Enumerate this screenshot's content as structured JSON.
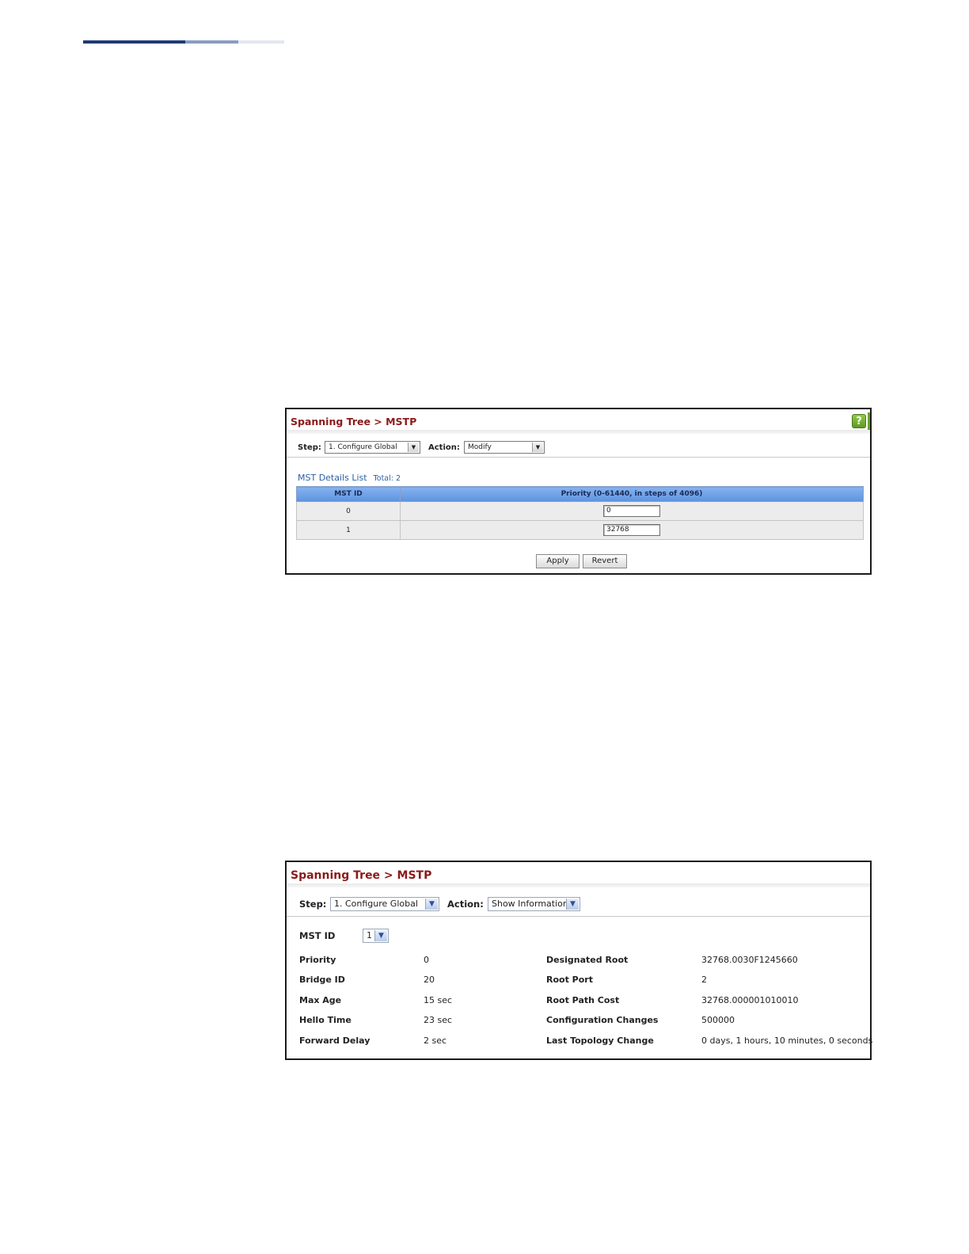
{
  "breadcrumb": "Spanning Tree > MSTP",
  "help_icon_glyph": "?",
  "config_panel": {
    "step_label": "Step:",
    "step_value": "1. Configure Global",
    "action_label": "Action:",
    "action_value": "Modify",
    "list_title": "MST Details List",
    "list_total": "Total: 2",
    "columns": [
      "MST ID",
      "Priority (0-61440, in steps of 4096)"
    ],
    "rows": [
      {
        "mst_id": "0",
        "priority": "0"
      },
      {
        "mst_id": "1",
        "priority": "32768"
      }
    ],
    "apply_label": "Apply",
    "revert_label": "Revert"
  },
  "info_panel": {
    "step_label": "Step:",
    "step_value": "1. Configure Global",
    "action_label": "Action:",
    "action_value": "Show Information",
    "mst_id_label": "MST ID",
    "mst_id_value": "1",
    "left": [
      {
        "label": "Priority",
        "value": "0"
      },
      {
        "label": "Bridge ID",
        "value": "20"
      },
      {
        "label": "Max Age",
        "value": "15 sec"
      },
      {
        "label": "Hello Time",
        "value": "23 sec"
      },
      {
        "label": "Forward Delay",
        "value": "2 sec"
      }
    ],
    "right": [
      {
        "label": "Designated Root",
        "value": "32768.0030F1245660"
      },
      {
        "label": "Root Port",
        "value": "2"
      },
      {
        "label": "Root Path Cost",
        "value": "32768.000001010010"
      },
      {
        "label": "Configuration Changes",
        "value": "500000"
      },
      {
        "label": "Last Topology Change",
        "value": "0 days, 1 hours, 10 minutes, 0 seconds"
      }
    ]
  },
  "colors": {
    "breadcrumb": "#8b1a1a",
    "table_header": "#6a9ee6",
    "list_title": "#2e5fa6"
  }
}
